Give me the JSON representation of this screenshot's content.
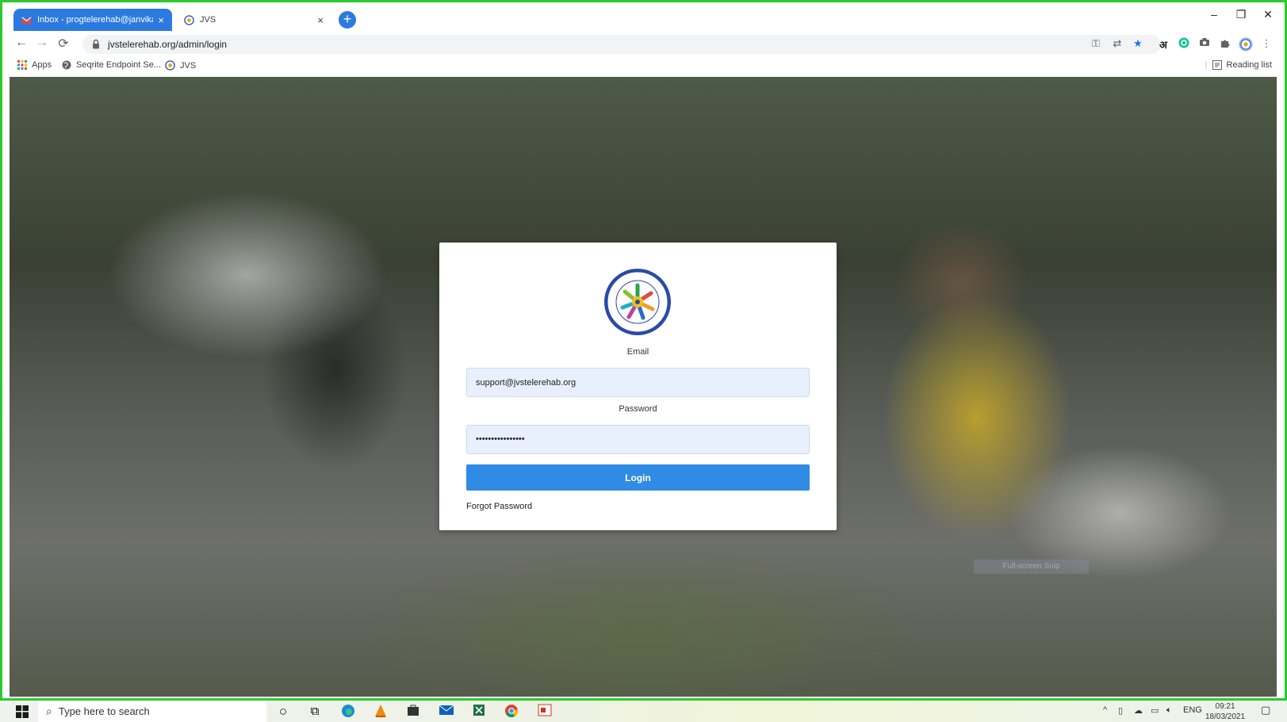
{
  "browser": {
    "tabs": [
      {
        "label": "Inbox - progtelerehab@janvikas",
        "active": true
      },
      {
        "label": "JVS",
        "active": false
      }
    ],
    "new_tab_glyph": "+",
    "tab_close_glyph": "×",
    "window_controls": {
      "minimize": "–",
      "restore": "❐",
      "close": "✕"
    },
    "nav": {
      "back": "←",
      "forward": "→",
      "reload": "⟳"
    },
    "url": "jvstelerehab.org/admin/login",
    "toolbar_icons": [
      "key-icon",
      "translate-icon",
      "star-icon",
      "hindi-input-icon",
      "grammarly-icon",
      "camera-icon",
      "extensions-icon",
      "profile-icon",
      "menu-icon"
    ],
    "hindi_glyph": "अ",
    "bookmarks": [
      {
        "label": "Apps",
        "icon": "apps-grid-icon"
      },
      {
        "label": "Seqrite Endpoint Se...",
        "icon": "globe-icon"
      },
      {
        "label": "JVS",
        "icon": "jvs-logo-icon"
      }
    ],
    "reading_list": "Reading list"
  },
  "login": {
    "email_label": "Email",
    "email_value": "support@jvstelerehab.org",
    "password_label": "Password",
    "password_value": "••••••••••••••••",
    "login_button": "Login",
    "forgot_password": "Forgot Password"
  },
  "overlay": {
    "snip_text": "Full-screen Snip"
  },
  "taskbar": {
    "search_placeholder": "Type here to search",
    "apps": [
      "cortana-icon",
      "task-view-icon",
      "edge-icon",
      "vlc-icon",
      "store-icon",
      "mail-icon",
      "excel-icon",
      "chrome-icon",
      "pdf-icon"
    ],
    "language": "ENG",
    "time": "09:21",
    "date": "18/03/2021"
  },
  "colors": {
    "accent": "#2f8be3",
    "tab_active": "#2b7ae0",
    "input_bg": "#e8f0fe",
    "screen_border": "#2ec92e"
  }
}
